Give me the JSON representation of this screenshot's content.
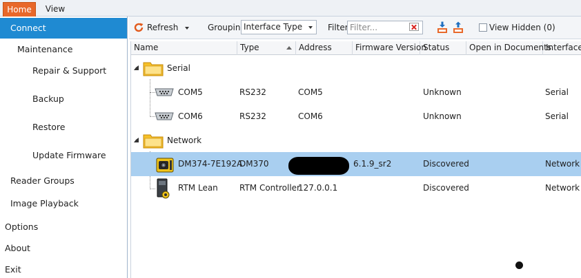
{
  "ribbon": {
    "tabs": [
      "Home",
      "View"
    ]
  },
  "sidebar": {
    "items": [
      {
        "label": "Connect"
      },
      {
        "label": "Maintenance"
      },
      {
        "label": "Repair & Support"
      },
      {
        "label": "Backup"
      },
      {
        "label": "Restore"
      },
      {
        "label": "Update Firmware"
      },
      {
        "label": "Reader Groups"
      },
      {
        "label": "Image Playback"
      },
      {
        "label": "Options"
      },
      {
        "label": "About"
      },
      {
        "label": "Exit"
      }
    ]
  },
  "toolbar": {
    "refresh_label": "Refresh",
    "grouping_label": "Grouping",
    "grouping_value": "Interface Type",
    "filter_label": "Filter",
    "filter_placeholder": "Filter...",
    "view_hidden_label": "View Hidden (0)"
  },
  "grid": {
    "columns": [
      "Name",
      "Type",
      "Address",
      "Firmware Version",
      "Status",
      "Open in Documents",
      "Interface"
    ],
    "groups": [
      {
        "name": "Serial",
        "rows": [
          {
            "name": "COM5",
            "type": "RS232",
            "address": "COM5",
            "firmware": "",
            "status": "Unknown",
            "open": "",
            "interface": "Serial"
          },
          {
            "name": "COM6",
            "type": "RS232",
            "address": "COM6",
            "firmware": "",
            "status": "Unknown",
            "open": "",
            "interface": "Serial"
          }
        ]
      },
      {
        "name": "Network",
        "rows": [
          {
            "name": "DM374-7E192A",
            "type": "DM370",
            "address": "",
            "firmware": "6.1.9_sr2",
            "status": "Discovered",
            "open": "",
            "interface": "Network"
          },
          {
            "name": "RTM Lean",
            "type": "RTM Controller",
            "address": "127.0.0.1",
            "firmware": "",
            "status": "Discovered",
            "open": "",
            "interface": "Network"
          }
        ]
      }
    ]
  },
  "colors": {
    "accent": "#1f8ad2",
    "home_tab": "#e8682a",
    "selected_row": "#a9cff0"
  }
}
